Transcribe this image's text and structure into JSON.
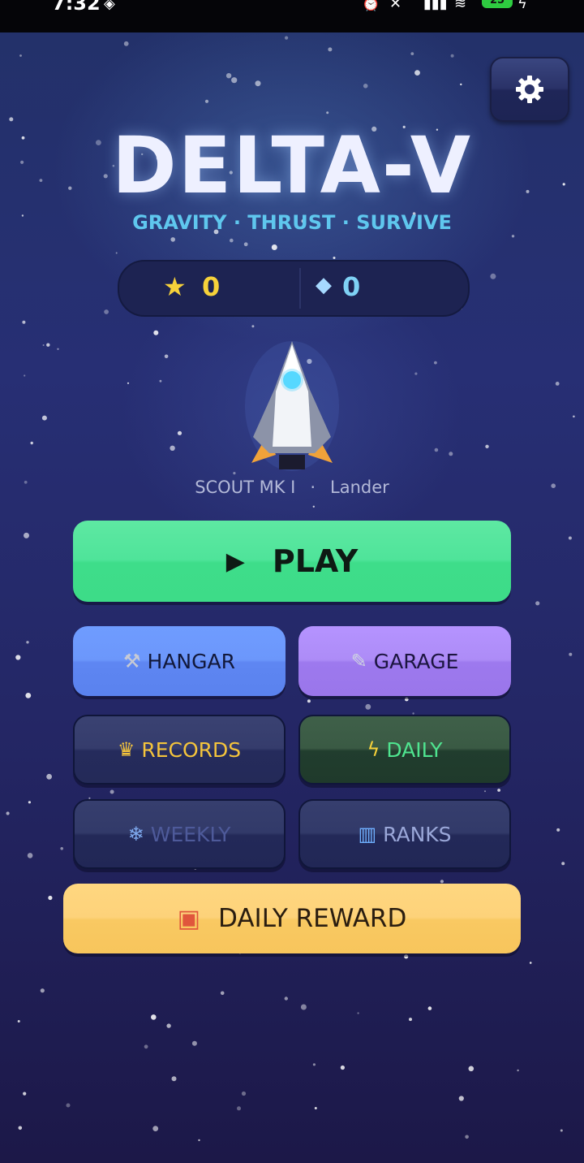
{
  "status_bar": {
    "time": "7:32",
    "battery": "25"
  },
  "game": {
    "title": "DELTA-V",
    "subtitle": "GRAVITY · THRUST · SURVIVE",
    "currency": {
      "stars": "0",
      "gems": "0"
    },
    "ship": {
      "name": "SCOUT MK I",
      "separator": "·",
      "class": "Lander"
    },
    "buttons": {
      "play": "PLAY",
      "hangar": "HANGAR",
      "garage": "GARAGE",
      "records": "RECORDS",
      "daily": "DAILY",
      "weekly": "WEEKLY",
      "ranks": "RANKS",
      "daily_reward": "DAILY REWARD"
    },
    "icons": {
      "settings": "gear-icon",
      "stars": "star-icon",
      "gems": "gem-icon",
      "play": "play-icon",
      "hangar": "hammer-wrench-icon",
      "garage": "wrench-icon",
      "records": "trophy-icon",
      "daily": "lightning-icon",
      "weekly": "snowflake-icon",
      "ranks": "bar-chart-icon",
      "daily_reward": "gift-icon"
    },
    "colors": {
      "play": "#4fe49a",
      "hangar": "#6c97fb",
      "garage": "#ad8cf7",
      "daily_text": "#4fe48f",
      "records_text": "#f4c43c",
      "reward": "#fdd27a",
      "title": "#eef0ff",
      "subtitle": "#5fc7ee"
    }
  }
}
